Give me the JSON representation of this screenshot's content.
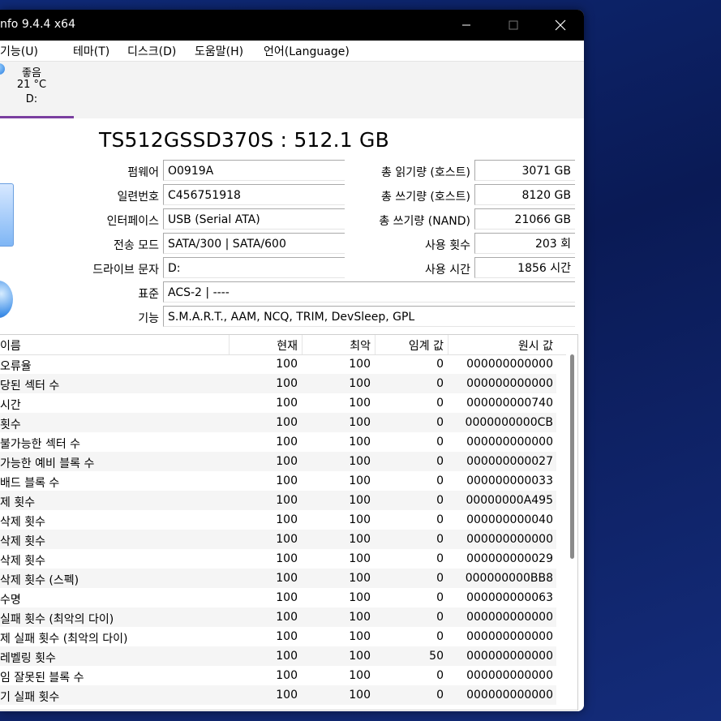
{
  "window": {
    "title": "nfo 9.4.4 x64",
    "min_icon": "minimize-icon",
    "max_icon": "maximize-icon",
    "close_icon": "close-icon"
  },
  "menu": {
    "items": [
      "기능(U)",
      "테마(T)",
      "디스크(D)",
      "도움말(H)",
      "언어(Language)"
    ]
  },
  "disk_tab": {
    "status": "좋음",
    "temp": "21 °C",
    "drive": "D:"
  },
  "model": "TS512GSSD370S : 512.1 GB",
  "info_left": [
    {
      "label": "펌웨어",
      "value": "O0919A"
    },
    {
      "label": "일련번호",
      "value": "C456751918"
    },
    {
      "label": "인터페이스",
      "value": "USB (Serial ATA)"
    },
    {
      "label": "전송 모드",
      "value": "SATA/300 | SATA/600"
    },
    {
      "label": "드라이브 문자",
      "value": "D:"
    }
  ],
  "info_right": [
    {
      "label": "총 읽기량 (호스트)",
      "value": "3071 GB"
    },
    {
      "label": "총 쓰기량 (호스트)",
      "value": "8120 GB"
    },
    {
      "label": "총 쓰기량 (NAND)",
      "value": "21066 GB"
    },
    {
      "label": "사용 횟수",
      "value": "203 회"
    },
    {
      "label": "사용 시간",
      "value": "1856 시간"
    }
  ],
  "standard": {
    "label": "표준",
    "value": "ACS-2 | ----"
  },
  "features": {
    "label": "기능",
    "value": "S.M.A.R.T., AAM, NCQ, TRIM, DevSleep, GPL"
  },
  "table": {
    "headers": [
      "이름",
      "현재",
      "최악",
      "임계 값",
      "원시 값"
    ],
    "rows": [
      [
        "오류율",
        "100",
        "100",
        "0",
        "000000000000"
      ],
      [
        "당된 섹터 수",
        "100",
        "100",
        "0",
        "000000000000"
      ],
      [
        "시간",
        "100",
        "100",
        "0",
        "000000000740"
      ],
      [
        "횟수",
        "100",
        "100",
        "0",
        "0000000000CB"
      ],
      [
        "불가능한 섹터 수",
        "100",
        "100",
        "0",
        "000000000000"
      ],
      [
        "가능한 예비 블록 수",
        "100",
        "100",
        "0",
        "000000000027"
      ],
      [
        "배드 블록 수",
        "100",
        "100",
        "0",
        "000000000033"
      ],
      [
        "제 횟수",
        "100",
        "100",
        "0",
        "00000000A495"
      ],
      [
        "삭제 횟수",
        "100",
        "100",
        "0",
        "000000000040"
      ],
      [
        "삭제 횟수",
        "100",
        "100",
        "0",
        "000000000000"
      ],
      [
        "삭제 횟수",
        "100",
        "100",
        "0",
        "000000000029"
      ],
      [
        "삭제 횟수 (스펙)",
        "100",
        "100",
        "0",
        "000000000BB8"
      ],
      [
        "수명",
        "100",
        "100",
        "0",
        "000000000063"
      ],
      [
        "실패 횟수 (최악의 다이)",
        "100",
        "100",
        "0",
        "000000000000"
      ],
      [
        "제 실패 횟수 (최악의 다이)",
        "100",
        "100",
        "0",
        "000000000000"
      ],
      [
        "레벨링 횟수",
        "100",
        "100",
        "50",
        "000000000000"
      ],
      [
        "임 잘못된 블록 수",
        "100",
        "100",
        "0",
        "000000000000"
      ],
      [
        "기 실패 횟수",
        "100",
        "100",
        "0",
        "000000000000"
      ]
    ]
  }
}
